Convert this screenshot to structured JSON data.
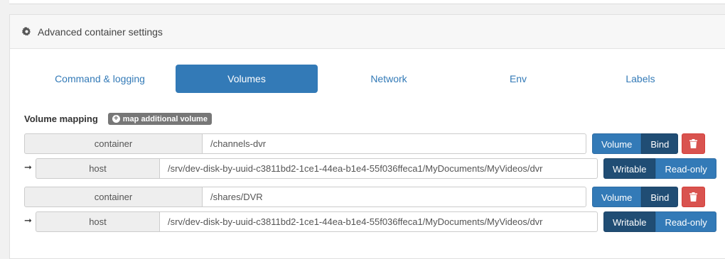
{
  "panel": {
    "title": "Advanced container settings",
    "title_icon": "gear-icon"
  },
  "tabs": [
    {
      "label": "Command & logging",
      "active": false
    },
    {
      "label": "Volumes",
      "active": true
    },
    {
      "label": "Network",
      "active": false
    },
    {
      "label": "Env",
      "active": false
    },
    {
      "label": "Labels",
      "active": false
    }
  ],
  "volume_mapping": {
    "title": "Volume mapping",
    "add_button": "map additional volume",
    "mappings": [
      {
        "container_label": "container",
        "container_path": "/channels-dvr",
        "type_options": [
          "Volume",
          "Bind"
        ],
        "type_selected": "Bind",
        "host_label": "host",
        "host_path": "/srv/dev-disk-by-uuid-c3811bd2-1ce1-44ea-b1e4-55f036ffeca1/MyDocuments/MyVideos/dvr",
        "mode_options": [
          "Writable",
          "Read-only"
        ],
        "mode_selected": "Writable"
      },
      {
        "container_label": "container",
        "container_path": "/shares/DVR",
        "type_options": [
          "Volume",
          "Bind"
        ],
        "type_selected": "Bind",
        "host_label": "host",
        "host_path": "/srv/dev-disk-by-uuid-c3811bd2-1ce1-44ea-b1e4-55f036ffeca1/MyDocuments/MyVideos/dvr",
        "mode_options": [
          "Writable",
          "Read-only"
        ],
        "mode_selected": "Writable"
      }
    ]
  },
  "colors": {
    "primary": "#337ab7",
    "primary_active": "#204d74",
    "danger": "#d9534f"
  }
}
